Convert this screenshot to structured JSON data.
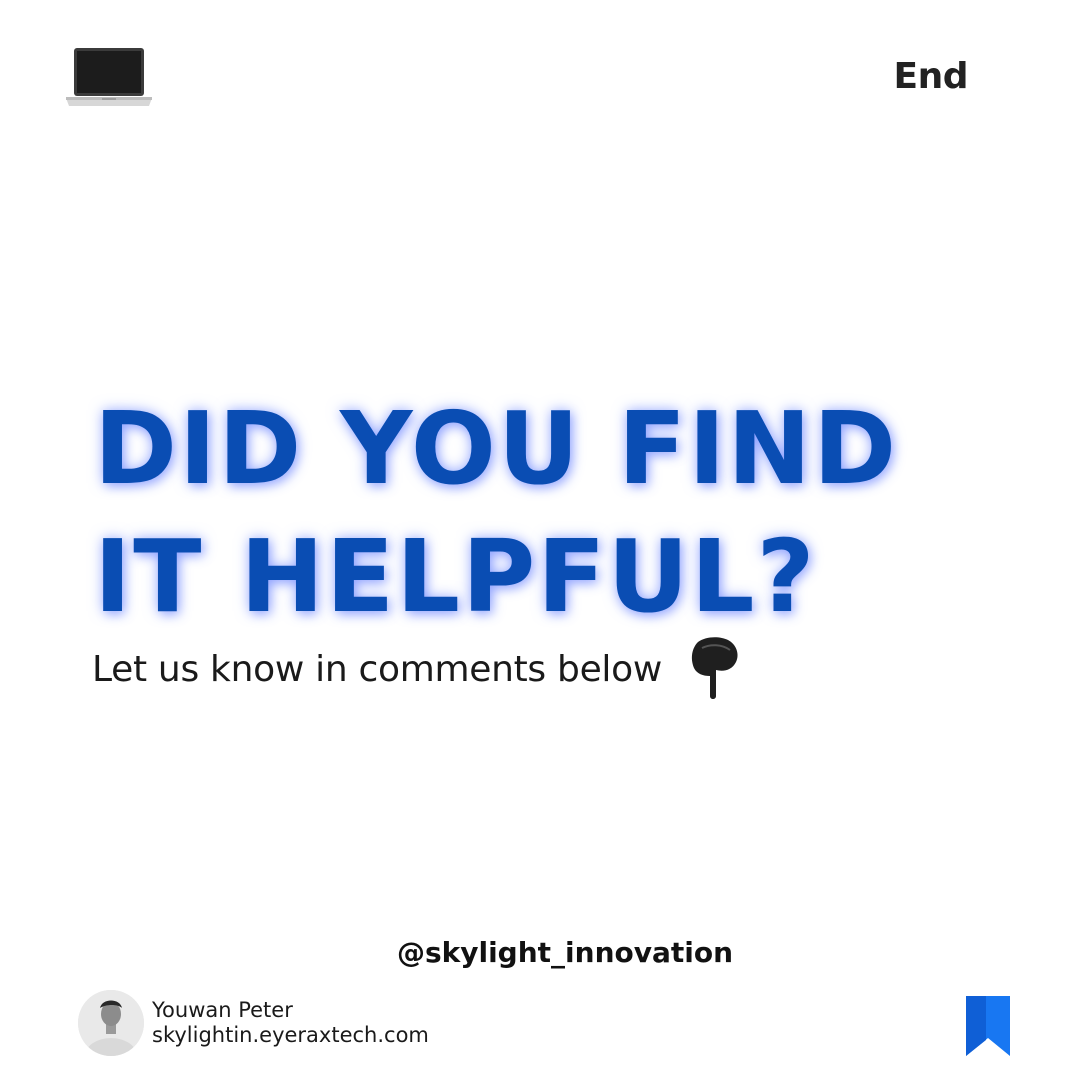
{
  "header": {
    "icon": "laptop-icon",
    "end_label": "End"
  },
  "main": {
    "headline_line1": "DID YOU FIND",
    "headline_line2": "IT HELPFUL?",
    "subtitle": "Let us know in comments below",
    "pointer_icon": "hand-pointing-down-icon"
  },
  "footer": {
    "handle": "@skylight_innovation",
    "author_name": "Youwan Peter",
    "author_site": "skylightin.eyeraxtech.com",
    "save_icon": "bookmark-icon"
  },
  "colors": {
    "headline": "#0a4db3",
    "headline_glow": "#6f85ff",
    "text": "#1a1a1a",
    "bookmark": "#1877f2"
  }
}
